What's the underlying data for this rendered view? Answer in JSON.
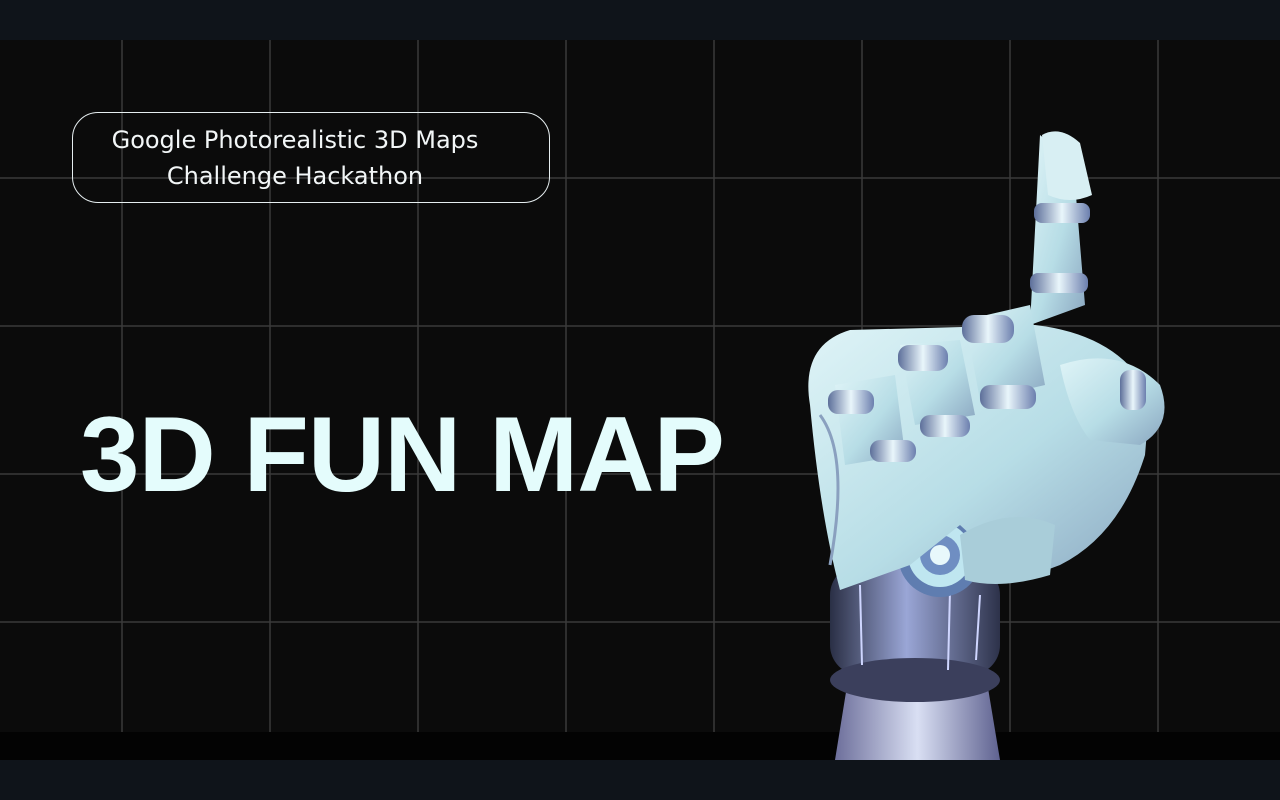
{
  "slide": {
    "subtitle_line1": "Google Photorealistic 3D Maps",
    "subtitle_line2": "Challenge Hackathon",
    "title": "3D FUN MAP"
  },
  "image": {
    "icon": "robot-hand-pointing-up"
  },
  "colors": {
    "background": "#0b0b0b",
    "letterbox": "#0f141a",
    "grid": "#3a3a3a",
    "title": "#e4fcfc",
    "pill_border": "#e6eef0",
    "robot_body": "#bfe4ea",
    "robot_shadow": "#7a8fa8",
    "robot_joint": "#8da0c8"
  }
}
